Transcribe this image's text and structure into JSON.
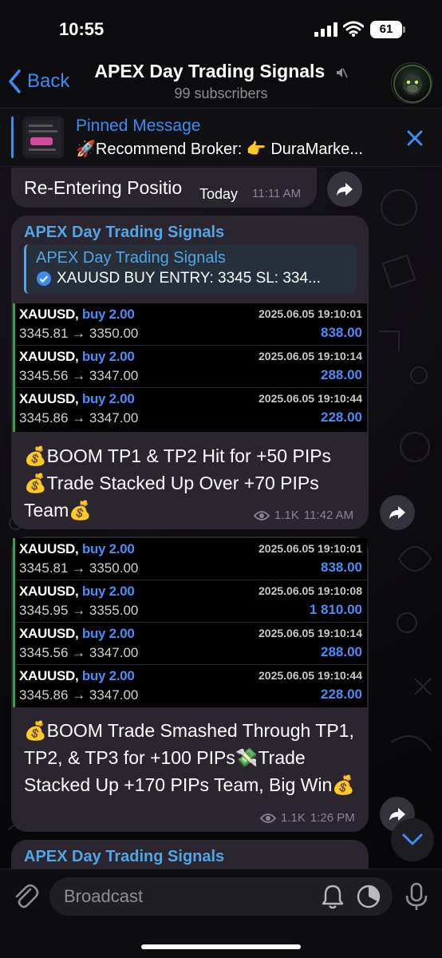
{
  "status_bar": {
    "time": "10:55",
    "battery": "61"
  },
  "header": {
    "back_label": "Back",
    "title": "APEX Day Trading Signals",
    "subtitle": "99 subscribers"
  },
  "pinned": {
    "title": "Pinned Message",
    "text": "🚀Recommend Broker: 👉 DuraMarke..."
  },
  "day_separator": "Today",
  "messages": {
    "m1": {
      "text": "Re-Entering Positio",
      "time": "11:11 AM"
    },
    "m2": {
      "sender": "APEX Day Trading Signals",
      "quote_sender": "APEX Day Trading Signals",
      "quote_text": "XAUUSD BUY ENTRY: 3345 SL: 334...",
      "trades": [
        {
          "symbol": "XAUUSD,",
          "side": "buy 2.00",
          "prices": "3345.81 → 3350.00",
          "date": "2025.06.05 19:10:01",
          "profit": "838.00"
        },
        {
          "symbol": "XAUUSD,",
          "side": "buy 2.00",
          "prices": "3345.56 → 3347.00",
          "date": "2025.06.05 19:10:14",
          "profit": "288.00"
        },
        {
          "symbol": "XAUUSD,",
          "side": "buy 2.00",
          "prices": "3345.86 → 3347.00",
          "date": "2025.06.05 19:10:44",
          "profit": "228.00"
        }
      ],
      "text": "💰BOOM TP1 & TP2 Hit for +50 PIPs💰Trade Stacked Up Over +70 PIPs Team💰",
      "views": "1.1K",
      "time": "11:42 AM"
    },
    "m3": {
      "trades": [
        {
          "symbol": "XAUUSD,",
          "side": "buy 2.00",
          "prices": "3345.81 → 3350.00",
          "date": "2025.06.05 19:10:01",
          "profit": "838.00"
        },
        {
          "symbol": "XAUUSD,",
          "side": "buy 2.00",
          "prices": "3345.95 → 3355.00",
          "date": "2025.06.05 19:10:08",
          "profit": "1 810.00"
        },
        {
          "symbol": "XAUUSD,",
          "side": "buy 2.00",
          "prices": "3345.56 → 3347.00",
          "date": "2025.06.05 19:10:14",
          "profit": "288.00"
        },
        {
          "symbol": "XAUUSD,",
          "side": "buy 2.00",
          "prices": "3345.86 → 3347.00",
          "date": "2025.06.05 19:10:44",
          "profit": "228.00"
        }
      ],
      "text": "💰BOOM Trade Smashed Through TP1, TP2, & TP3 for +100 PIPs💸Trade Stacked Up +170 PIPs Team, Big Win💰",
      "views": "1.1K",
      "time": "1:26 PM"
    },
    "m4": {
      "sender": "APEX Day Trading Signals"
    }
  },
  "input": {
    "placeholder": "Broadcast"
  },
  "colors": {
    "accent": "#3c8cf2",
    "bubble": "#2b2530",
    "profit": "#4b8cf6",
    "trade_bar": "#3e9b4a"
  }
}
